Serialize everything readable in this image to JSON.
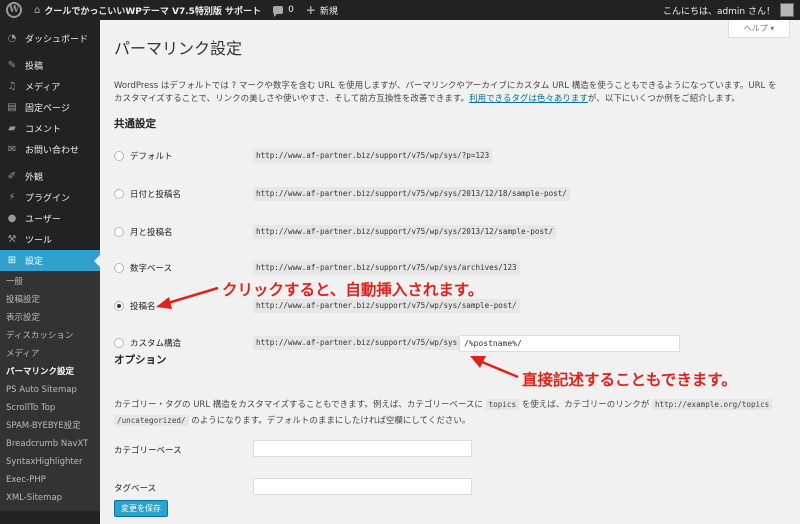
{
  "adminbar": {
    "logo": "W",
    "site_name": "クールでかっこいいWPテーマ V7.5特別版 サポート",
    "comments_count": "0",
    "new_label": "新規",
    "greeting": "こんにちは、admin さん！"
  },
  "sidebar": {
    "items": [
      {
        "label": "ダッシュボード",
        "icon": "dashboard-icon"
      },
      {
        "label": "投稿",
        "icon": "pin-icon"
      },
      {
        "label": "メディア",
        "icon": "media-icon"
      },
      {
        "label": "固定ページ",
        "icon": "page-icon"
      },
      {
        "label": "コメント",
        "icon": "comment-icon"
      },
      {
        "label": "お問い合わせ",
        "icon": "mail-icon"
      },
      {
        "label": "外観",
        "icon": "appearance-icon"
      },
      {
        "label": "プラグイン",
        "icon": "plugin-icon"
      },
      {
        "label": "ユーザー",
        "icon": "user-icon"
      },
      {
        "label": "ツール",
        "icon": "tools-icon"
      },
      {
        "label": "設定",
        "icon": "settings-icon"
      }
    ],
    "submenu": [
      "一般",
      "投稿設定",
      "表示設定",
      "ディスカッション",
      "メディア",
      "パーマリンク設定",
      "PS Auto Sitemap",
      "ScrollTo Top",
      "SPAM-BYEBYE設定",
      "Breadcrumb NavXT",
      "SyntaxHighlighter",
      "Exec-PHP",
      "XML-Sitemap"
    ]
  },
  "help_label": "ヘルプ ▾",
  "page_title": "パーマリンク設定",
  "intro": {
    "text1": "WordPress はデフォルトでは ? マークや数字を含む URL を使用しますが、パーマリンクやアーカイブにカスタム URL 構造を使うこともできるようになっています。URL をカスタマイズすることで、リンクの美しさや使いやすさ、そして前方互換性を改善できます。",
    "link": "利用できるタグは色々あります",
    "text2": "が、以下にいくつか例をご紹介します。"
  },
  "common_heading": "共通設定",
  "permalink_options": [
    {
      "label": "デフォルト",
      "example": "http://www.af-partner.biz/support/v75/wp/sys/?p=123",
      "checked": false
    },
    {
      "label": "日付と投稿名",
      "example": "http://www.af-partner.biz/support/v75/wp/sys/2013/12/18/sample-post/",
      "checked": false
    },
    {
      "label": "月と投稿名",
      "example": "http://www.af-partner.biz/support/v75/wp/sys/2013/12/sample-post/",
      "checked": false
    },
    {
      "label": "数字ベース",
      "example": "http://www.af-partner.biz/support/v75/wp/sys/archives/123",
      "checked": false
    },
    {
      "label": "投稿名",
      "example": "http://www.af-partner.biz/support/v75/wp/sys/sample-post/",
      "checked": true
    },
    {
      "label": "カスタム構造",
      "example": "http://www.af-partner.biz/support/v75/wp/sys",
      "checked": false
    }
  ],
  "custom_structure_value": "/%postname%/",
  "annotations": {
    "click": "クリックすると、自動挿入されます。",
    "direct": "直接記述することもできます。"
  },
  "annotation_color": "#e0231a",
  "options_heading": "オプション",
  "options_desc": {
    "a": "カテゴリー・タグの URL 構造をカスタマイズすることもできます。例えば、カテゴリーベースに ",
    "code1": "topics",
    "b": " を使えば、カテゴリーのリンクが ",
    "code2": "http://example.org/topics",
    "code3": "/uncategorized/",
    "c": " のようになります。デフォルトのままにしたければ空欄にしてください。"
  },
  "category_base_label": "カテゴリーベース",
  "tag_base_label": "タグベース",
  "category_base_value": "",
  "tag_base_value": "",
  "save_label": "変更を保存"
}
